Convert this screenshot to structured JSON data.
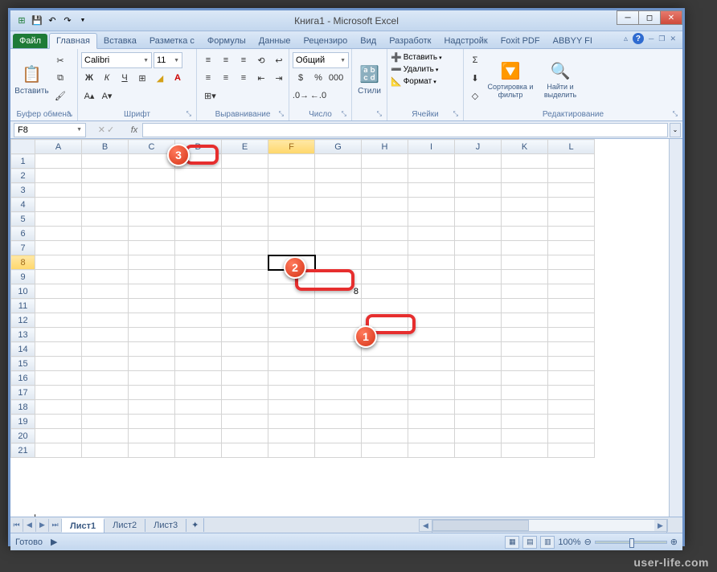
{
  "title": "Книга1 - Microsoft Excel",
  "qat": {
    "save": "💾",
    "undo": "↶",
    "redo": "↷"
  },
  "tabs": {
    "file": "Файл",
    "home": "Главная",
    "insert": "Вставка",
    "layout": "Разметка с",
    "formulas": "Формулы",
    "data": "Данные",
    "review": "Рецензиро",
    "view": "Вид",
    "developer": "Разработк",
    "addins": "Надстройк",
    "foxit": "Foxit PDF",
    "abbyy": "ABBYY FI"
  },
  "ribbon": {
    "clipboard": {
      "paste": "Вставить",
      "label": "Буфер обмена"
    },
    "font": {
      "name": "Calibri",
      "size": "11",
      "label": "Шрифт"
    },
    "align": {
      "label": "Выравнивание"
    },
    "number": {
      "format": "Общий",
      "label": "Число"
    },
    "styles": {
      "btn": "Стили",
      "label": ""
    },
    "cells": {
      "insert": "Вставить",
      "delete": "Удалить",
      "format": "Формат",
      "label": "Ячейки"
    },
    "editing": {
      "sort": "Сортировка и фильтр",
      "find": "Найти и выделить",
      "label": "Редактирование"
    }
  },
  "namebox": "F8",
  "fx": "fx",
  "columns": [
    "A",
    "B",
    "C",
    "D",
    "E",
    "F",
    "G",
    "H",
    "I",
    "J",
    "K",
    "L"
  ],
  "rows": [
    "1",
    "2",
    "3",
    "4",
    "5",
    "6",
    "7",
    "8",
    "9",
    "10",
    "11",
    "12",
    "13",
    "14",
    "15",
    "16",
    "17",
    "18",
    "19",
    "20",
    "21"
  ],
  "selected_col": "F",
  "selected_row": "8",
  "cell_g10": "8",
  "sheets": {
    "s1": "Лист1",
    "s2": "Лист2",
    "s3": "Лист3"
  },
  "status": "Готово",
  "zoom": "100%",
  "callouts": {
    "c1": "1",
    "c2": "2",
    "c3": "3"
  },
  "watermark": "user-life.com"
}
